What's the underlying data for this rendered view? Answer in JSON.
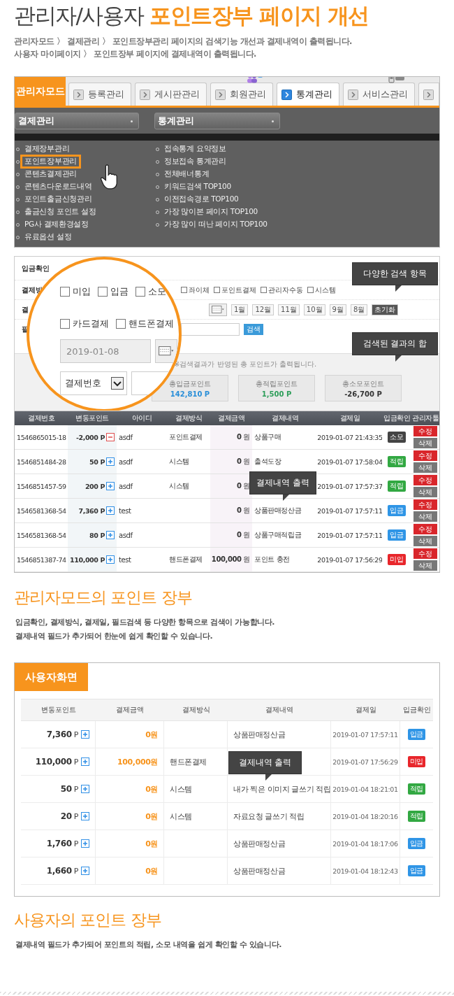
{
  "title": "관리자/사용자 **포인트장부 페이지 개선**",
  "intro": [
    "관리자모드 〉 결제관리 〉 포인트장부관리 페이지의 검색기능 개선과 결제내역이 출력됩니다.",
    "사용자 마이페이지 〉 포인트장부 페이지에 결제내역이 출력됩니다."
  ],
  "admin_menu": {
    "mode_label": "관리자모드",
    "tabs": [
      {
        "label": "등록관리",
        "selected": false,
        "kind": "plain"
      },
      {
        "label": "게시판관리",
        "selected": false,
        "kind": "plain"
      },
      {
        "label": "회원관리",
        "selected": false,
        "kind": "people"
      },
      {
        "label": "통계관리",
        "selected": true,
        "kind": "plain"
      },
      {
        "label": "서비스관리",
        "selected": false,
        "kind": "phone"
      }
    ],
    "menus": [
      {
        "title": "결제관리",
        "items": [
          {
            "label": "결제장부관리",
            "selected": false
          },
          {
            "label": "포인트장부관리",
            "selected": true
          },
          {
            "label": "콘텐츠결제관리",
            "selected": false
          },
          {
            "label": "콘텐츠다운로드내역",
            "selected": false
          },
          {
            "label": "포인트출금신청관리",
            "selected": false
          },
          {
            "label": "출금신청 포인트 설정",
            "selected": false
          },
          {
            "label": "PG사 결제환경설정",
            "selected": false
          },
          {
            "label": "유료옵션 설정",
            "selected": false
          }
        ]
      },
      {
        "title": "통계관리",
        "items": [
          {
            "label": "접속통계 요약정보",
            "selected": false
          },
          {
            "label": "정보접속 통계관리",
            "selected": false
          },
          {
            "label": "전체배너통계",
            "selected": false
          },
          {
            "label": "키워드검색 TOP100",
            "selected": false
          },
          {
            "label": "이전접속경로 TOP100",
            "selected": false
          },
          {
            "label": "가장 많이본 페이지 TOP100",
            "selected": false
          },
          {
            "label": "가장 많이 떠난 페이지 TOP100",
            "selected": false
          }
        ]
      }
    ]
  },
  "search": {
    "labels": [
      "입금확인",
      "결제방",
      "결",
      "필"
    ],
    "method_options": [
      {
        "label": "좌이체",
        "checked": false
      },
      {
        "label": "포인트결제",
        "checked": false
      },
      {
        "label": "관리자수동",
        "checked": false
      },
      {
        "label": "시스템",
        "checked": false
      }
    ],
    "months": [
      "1월",
      "12월",
      "11월",
      "10월",
      "9월",
      "8월"
    ],
    "reset_button": "초기화",
    "search_button": "검색",
    "note": "※검색결과가 반영된 총 포인트가 출력됩니다.",
    "totals": [
      {
        "label": "총입금포인트",
        "value": "142,810 P",
        "color": "#2a8fd8"
      },
      {
        "label": "총적립포인트",
        "value": "1,500 P",
        "color": "#2e9e5a"
      },
      {
        "label": "총소모포인트",
        "value": "-26,700 P",
        "color": "#333333"
      }
    ],
    "zoom": {
      "deposit_options": [
        {
          "label": "미입",
          "checked": false
        },
        {
          "label": "입금",
          "checked": false
        },
        {
          "label": "소모",
          "checked": false
        }
      ],
      "method_options": [
        {
          "label": "카드결제",
          "checked": false
        },
        {
          "label": "핸드폰결제",
          "checked": false
        }
      ],
      "date": "2019-01-08",
      "field_select": "결제번호"
    },
    "callouts": [
      "다양한 검색 항목",
      "검색된 결과의 합"
    ]
  },
  "admin_table": {
    "columns": [
      "결제번호",
      "변동포인트",
      "아이디",
      "결제방식",
      "결제금액",
      "결제내역",
      "결제일",
      "입금확인",
      "관리자툴"
    ],
    "rows": [
      {
        "kind": "minus",
        "no": "1546865015-18",
        "points": "-2,000 P",
        "user": "asdf",
        "method": "포인트결제",
        "amount": "**0** 원",
        "detail": "상품구매",
        "date": "2019-01-07 21:43:35",
        "status": {
          "label": "소모",
          "kind": "spend"
        },
        "actions": [
          "수정",
          "삭제"
        ]
      },
      {
        "kind": "plus",
        "no": "1546851484-28",
        "points": "50 P",
        "user": "asdf",
        "method": "시스템",
        "amount": "**0** 원",
        "detail": "출석도장",
        "date": "2019-01-07 17:58:04",
        "status": {
          "label": "적립",
          "kind": "earn"
        },
        "actions": [
          "수정",
          "삭제"
        ]
      },
      {
        "kind": "plus",
        "no": "1546851457-59",
        "points": "200 P",
        "user": "asdf",
        "method": "시스템",
        "amount": "**0** 원",
        "date": "2019-01-07 17:57:37",
        "status": {
          "label": "적립",
          "kind": "earn"
        },
        "actions": [
          "수정",
          "삭제"
        ]
      },
      {
        "kind": "plus",
        "no": "1546581368-54",
        "points": "7,360 P",
        "user": "test",
        "amount": "**0** 원",
        "detail": "상품판매정산금",
        "date": "2019-01-07 17:57:11",
        "status": {
          "label": "입금",
          "kind": "deposit"
        },
        "actions": [
          "수정",
          "삭제"
        ]
      },
      {
        "kind": "plus",
        "no": "1546581368-54",
        "points": "80 P",
        "user": "asdf",
        "amount": "**0** 원",
        "detail": "상품구매적립금",
        "date": "2019-01-07 17:57:11",
        "status": {
          "label": "입금",
          "kind": "deposit"
        },
        "actions": [
          "수정",
          "삭제"
        ]
      },
      {
        "kind": "plus",
        "no": "1546851387-74",
        "points": "110,000 P",
        "user": "test",
        "method": "핸드폰결제",
        "amount": "**100,000** 원",
        "detail": "포인트 충전",
        "date": "2019-01-07 17:56:29",
        "status": {
          "label": "미입",
          "kind": "unpaid"
        },
        "actions": [
          "수정",
          "삭제"
        ]
      }
    ],
    "callout": "결제내역 출력"
  },
  "admin_section": {
    "heading": "관리자모드의 포인트 장부",
    "lines": [
      "입금확인, 결제방식, 결제일, 필드검색 등 다양한 항목으로 검색이 가능합니다.",
      "결제내역 필드가 추가되어 한눈에 쉽게 확인할 수 있습니다."
    ]
  },
  "user_screen": {
    "label": "사용자화면",
    "columns": [
      "변동포인트",
      "결제금액",
      "결제방식",
      "결제내역",
      "결제일",
      "입금확인"
    ],
    "rows": [
      {
        "points": "**7,360** P",
        "amount": "0원",
        "detail": "상품판매정산금",
        "date": "2019-01-07 17:57:11",
        "status": {
          "label": "입금",
          "kind": "deposit"
        }
      },
      {
        "points": "**110,000** P",
        "amount": "100,000원",
        "method": "핸드폰결제",
        "date": "2019-01-07 17:56:29",
        "status": {
          "label": "미입",
          "kind": "unpaid"
        }
      },
      {
        "points": "**50** P",
        "amount": "0원",
        "method": "시스템",
        "detail": "내가 찍은 이미지 글쓰기 적립",
        "date": "2019-01-04 18:21:01",
        "status": {
          "label": "적립",
          "kind": "earn"
        }
      },
      {
        "points": "**20** P",
        "amount": "0원",
        "method": "시스템",
        "detail": "자료요청 글쓰기 적립",
        "date": "2019-01-04 18:20:16",
        "status": {
          "label": "적립",
          "kind": "earn"
        }
      },
      {
        "points": "**1,760** P",
        "amount": "0원",
        "detail": "상품판매정산금",
        "date": "2019-01-04 18:17:06",
        "status": {
          "label": "입금",
          "kind": "deposit"
        }
      },
      {
        "points": "**1,660** P",
        "amount": "0원",
        "detail": "상품판매정산금",
        "date": "2019-01-04 18:12:43",
        "status": {
          "label": "입금",
          "kind": "deposit"
        }
      }
    ],
    "callout": "결제내역 출력"
  },
  "user_section": {
    "heading": "사용자의 포인트 장부",
    "lines": [
      "결제내역 필드가 추가되어 포인트의 적립, 소모 내역을 쉽게 확인할 수 있습니다."
    ]
  }
}
